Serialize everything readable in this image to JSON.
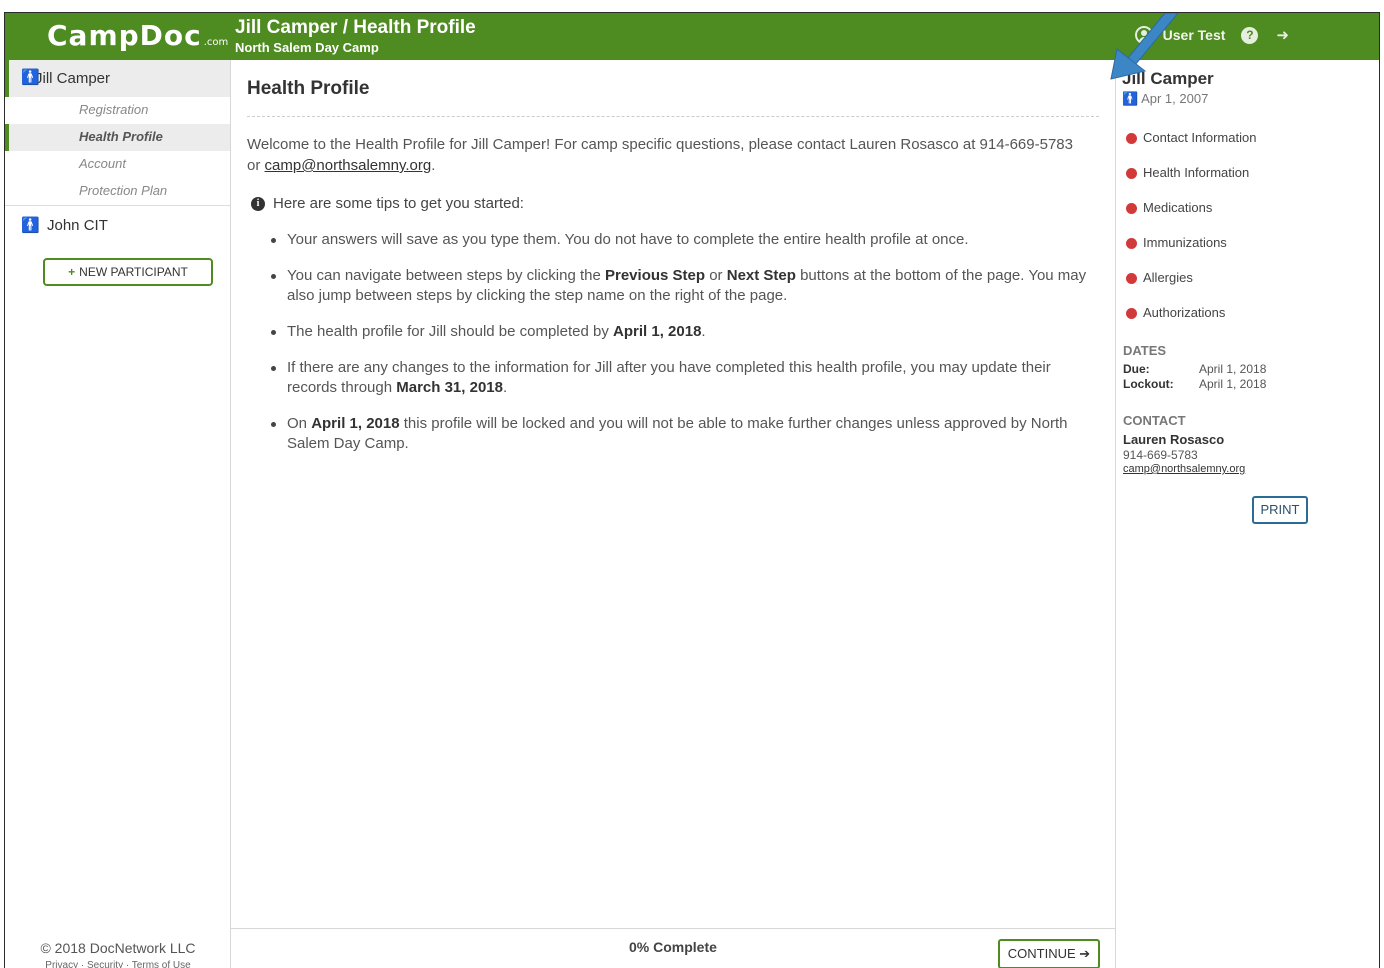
{
  "header": {
    "logo": "CampDoc",
    "logo_suffix": ".com",
    "title": "Jill Camper / Health Profile",
    "subtitle": "North Salem Day Camp",
    "user_name": "User Test",
    "help_icon": "question-circle-icon",
    "logout_icon": "sign-out-icon"
  },
  "sidebar": {
    "participants": [
      {
        "name": "Jill Camper",
        "active": true,
        "subitems": [
          {
            "label": "Registration",
            "active": false
          },
          {
            "label": "Health Profile",
            "active": true
          },
          {
            "label": "Account",
            "active": false
          },
          {
            "label": "Protection Plan",
            "active": false
          }
        ]
      },
      {
        "name": "John CIT",
        "active": false
      }
    ],
    "new_participant_label": "NEW PARTICIPANT",
    "copyright": "© 2018 DocNetwork LLC",
    "footer_links": "Privacy · Security · Terms of Use"
  },
  "main": {
    "title": "Health Profile",
    "welcome_text": "Welcome to the Health Profile for Jill Camper! For camp specific questions, please contact Lauren Rosasco at 914-669-5783 or",
    "welcome_email": "camp@northsalemny.org",
    "tips_heading": "Here are some tips to get you started:",
    "tips": {
      "t1": "Your answers will save as you type them. You do not have to complete the entire health profile at once.",
      "t2_a": "You can navigate between steps by clicking the",
      "t2_b1": "Previous Step",
      "t2_or": "or",
      "t2_b2": "Next Step",
      "t2_c": "buttons at the bottom of the page. You may also jump between steps by clicking the step name on the right of the page.",
      "t3_a": "The health profile for Jill should be completed by",
      "t3_b": "April 1, 2018",
      "t4_a": "If there are any changes to the information for Jill after you have completed this health profile, you may update their records through",
      "t4_b": "March 31, 2018",
      "t5_pre": "On",
      "t5_b": "April 1, 2018",
      "t5_c": "this profile will be locked and you will not be able to make further changes unless approved by North Salem Day Camp."
    },
    "progress_text": "0% Complete",
    "progress_percent": 0,
    "continue_label": "CONTINUE"
  },
  "right": {
    "name": "Jill Camper",
    "dob": "Apr 1, 2007",
    "steps": [
      "Contact Information",
      "Health Information",
      "Medications",
      "Immunizations",
      "Allergies",
      "Authorizations"
    ],
    "step_status_color": "#d23a3a",
    "dates_heading": "DATES",
    "due_label": "Due:",
    "due_value": "April 1, 2018",
    "lockout_label": "Lockout:",
    "lockout_value": "April 1, 2018",
    "contact_heading": "CONTACT",
    "contact_name": "Lauren Rosasco",
    "contact_phone": "914-669-5783",
    "contact_email": "camp@northsalemny.org",
    "print_label": "PRINT"
  },
  "colors": {
    "brand_green": "#4e8b21",
    "arrow_blue": "#3d86c6"
  }
}
